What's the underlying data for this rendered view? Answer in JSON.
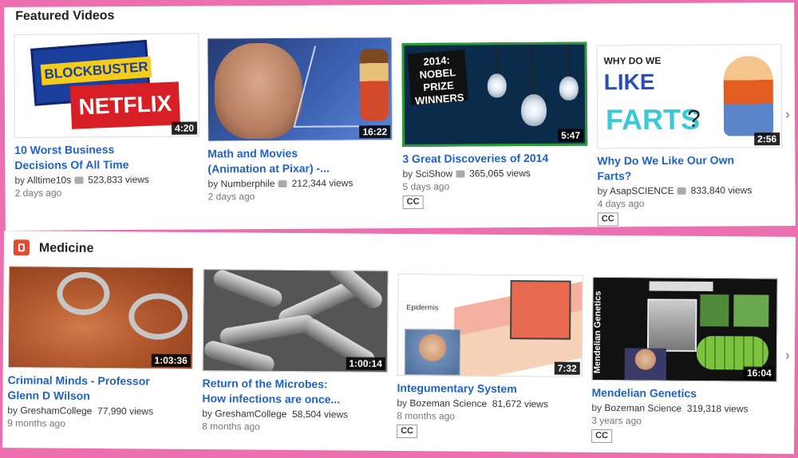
{
  "sections": [
    {
      "title": "Featured Videos",
      "videos": [
        {
          "title_line1": "10 Worst Business",
          "title_line2": "Decisions Of All Time",
          "by": "by",
          "channel": "Alltime10s",
          "views": "523,833 views",
          "age": "2 days ago",
          "duration": "4:20",
          "cc": "",
          "thumb_text_1": "BLOCKBUSTER",
          "thumb_text_2": "NETFLIX"
        },
        {
          "title_line1": "Math and Movies",
          "title_line2": "(Animation at Pixar) -...",
          "by": "by",
          "channel": "Numberphile",
          "views": "212,344 views",
          "age": "2 days ago",
          "duration": "16:22",
          "cc": ""
        },
        {
          "title_line1": "3 Great Discoveries of 2014",
          "title_line2": "",
          "by": "by",
          "channel": "SciShow",
          "views": "365,065 views",
          "age": "5 days ago",
          "duration": "5:47",
          "cc": "CC",
          "thumb_text_1": "2014: NOBEL PRIZE WINNERS"
        },
        {
          "title_line1": "Why Do We Like Our Own",
          "title_line2": "Farts?",
          "by": "by",
          "channel": "AsapSCIENCE",
          "views": "833,840 views",
          "age": "4 days ago",
          "duration": "2:56",
          "cc": "CC",
          "thumb_text_1": "WHY DO WE",
          "thumb_text_2": "LIKE",
          "thumb_text_3": "FARTS"
        }
      ]
    },
    {
      "title": "Medicine",
      "videos": [
        {
          "title_line1": "Criminal Minds - Professor",
          "title_line2": "Glenn D Wilson",
          "by": "by",
          "channel": "GreshamCollege",
          "views": "77,990 views",
          "age": "9 months ago",
          "duration": "1:03:36",
          "cc": ""
        },
        {
          "title_line1": "Return of the Microbes:",
          "title_line2": "How infections are once...",
          "by": "by",
          "channel": "GreshamCollege",
          "views": "58,504 views",
          "age": "8 months ago",
          "duration": "1:00:14",
          "cc": ""
        },
        {
          "title_line1": "Integumentary System",
          "title_line2": "",
          "by": "by",
          "channel": "Bozeman Science",
          "views": "81,672 views",
          "age": "8 months ago",
          "duration": "7:32",
          "cc": "CC",
          "thumb_text_1": "Epidermis"
        },
        {
          "title_line1": "Mendelian Genetics",
          "title_line2": "",
          "by": "by",
          "channel": "Bozeman Science",
          "views": "319,318 views",
          "age": "3 years ago",
          "duration": "16:04",
          "cc": "CC",
          "thumb_text_1": "Mendelian Genetics"
        }
      ]
    }
  ],
  "icons": {
    "next": "chevron-right-icon",
    "section": "medicine-channel-icon",
    "verified": "verified-icon"
  },
  "colors": {
    "link": "#1f62c7",
    "background": "#ec6fb0",
    "section_icon": "#e3492f"
  }
}
